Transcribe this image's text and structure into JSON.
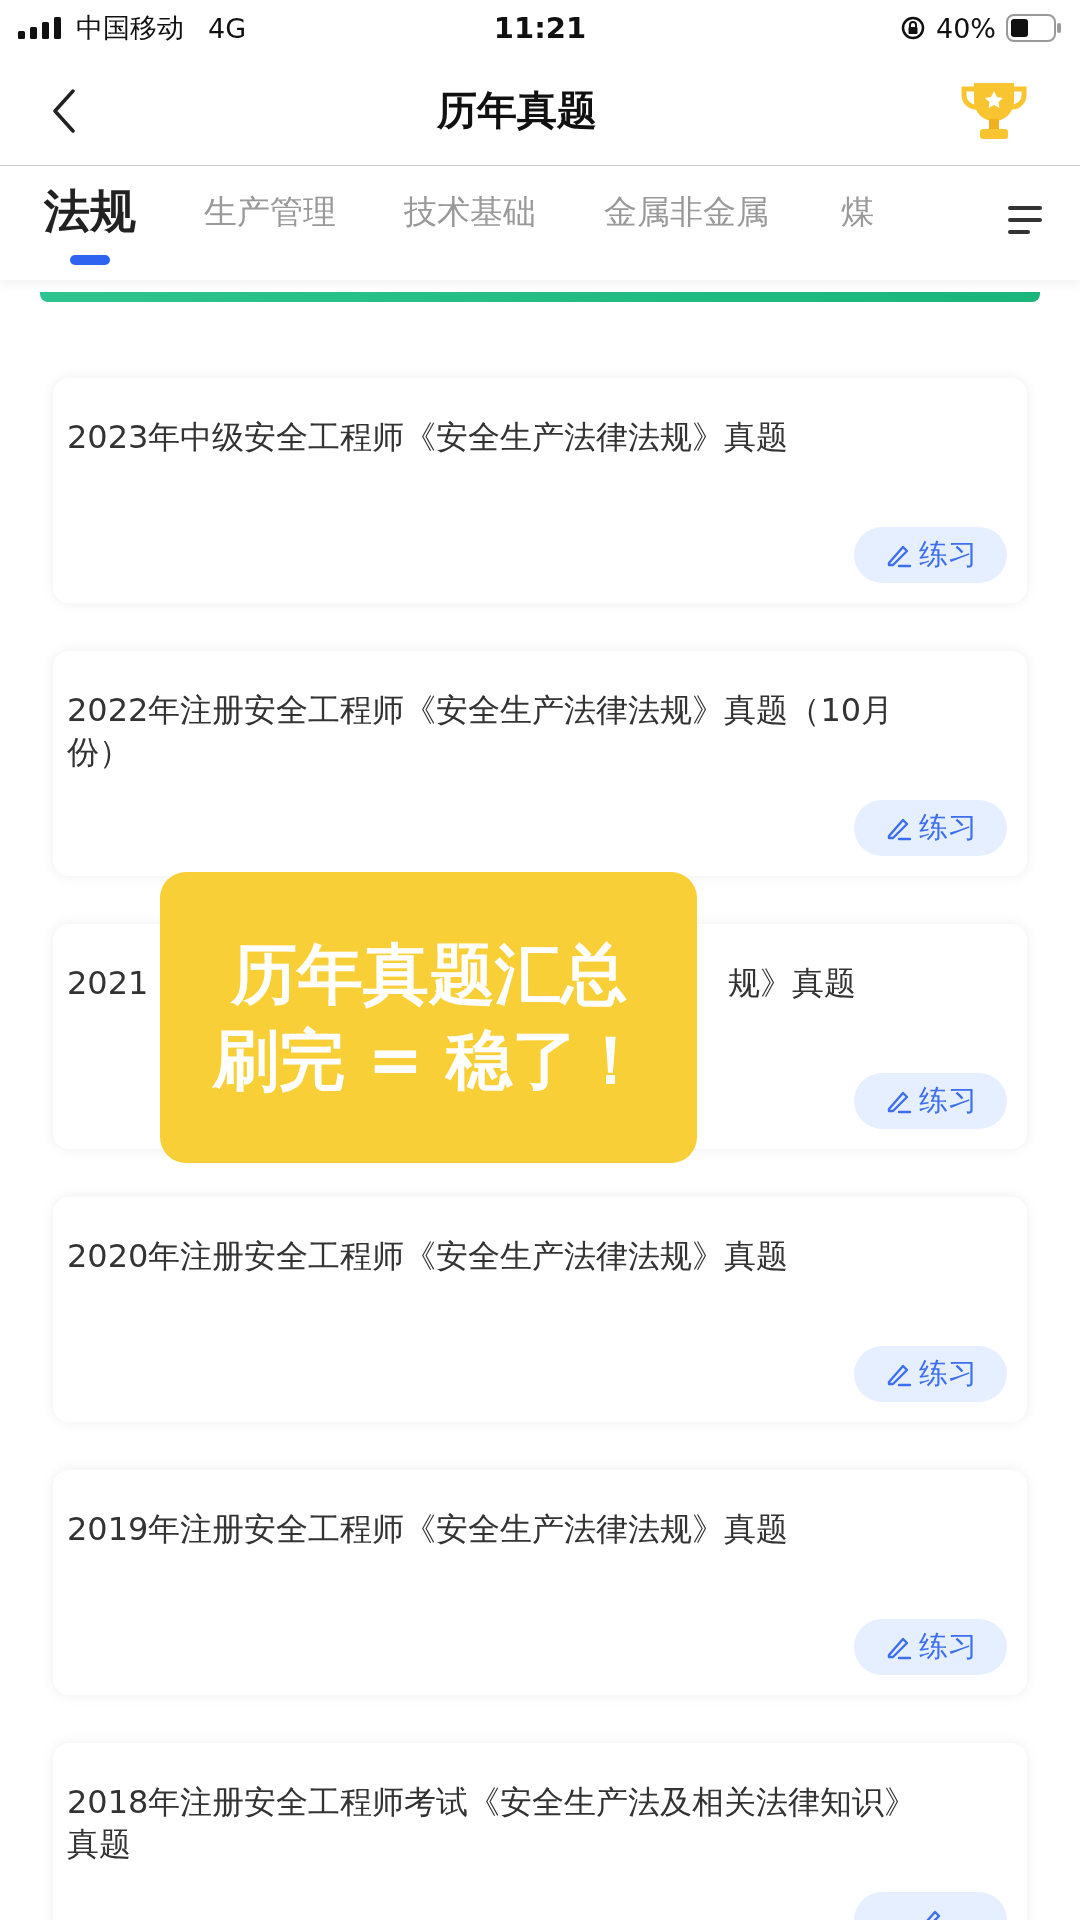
{
  "status_bar": {
    "carrier": "中国移动",
    "network": "4G",
    "time": "11:21",
    "battery": "40%"
  },
  "nav": {
    "title": "历年真题"
  },
  "tabs": [
    {
      "label": "法规",
      "selected": true
    },
    {
      "label": "生产管理",
      "selected": false
    },
    {
      "label": "技术基础",
      "selected": false
    },
    {
      "label": "金属非金属",
      "selected": false
    },
    {
      "label": "煤",
      "selected": false
    }
  ],
  "cards": [
    {
      "kind": "full",
      "title": "2023年中级安全工程师《安全生产法律法规》真题",
      "button": "练习"
    },
    {
      "kind": "full",
      "title": "2022年注册安全工程师《安全生产法律法规》真题（10月份）",
      "button": "练习"
    },
    {
      "kind": "covered",
      "title_start": "2021",
      "title_end": "规》真题",
      "button": "练习"
    },
    {
      "kind": "full",
      "title": "2020年注册安全工程师《安全生产法律法规》真题",
      "button": "练习"
    },
    {
      "kind": "full",
      "title": "2019年注册安全工程师《安全生产法律法规》真题",
      "button": "练习"
    },
    {
      "kind": "full",
      "title": "2018年注册安全工程师考试《安全生产法及相关法律知识》真题"
    }
  ],
  "sticker": {
    "lines": [
      "历年真题汇总",
      "刷完 = 稳了！"
    ]
  }
}
